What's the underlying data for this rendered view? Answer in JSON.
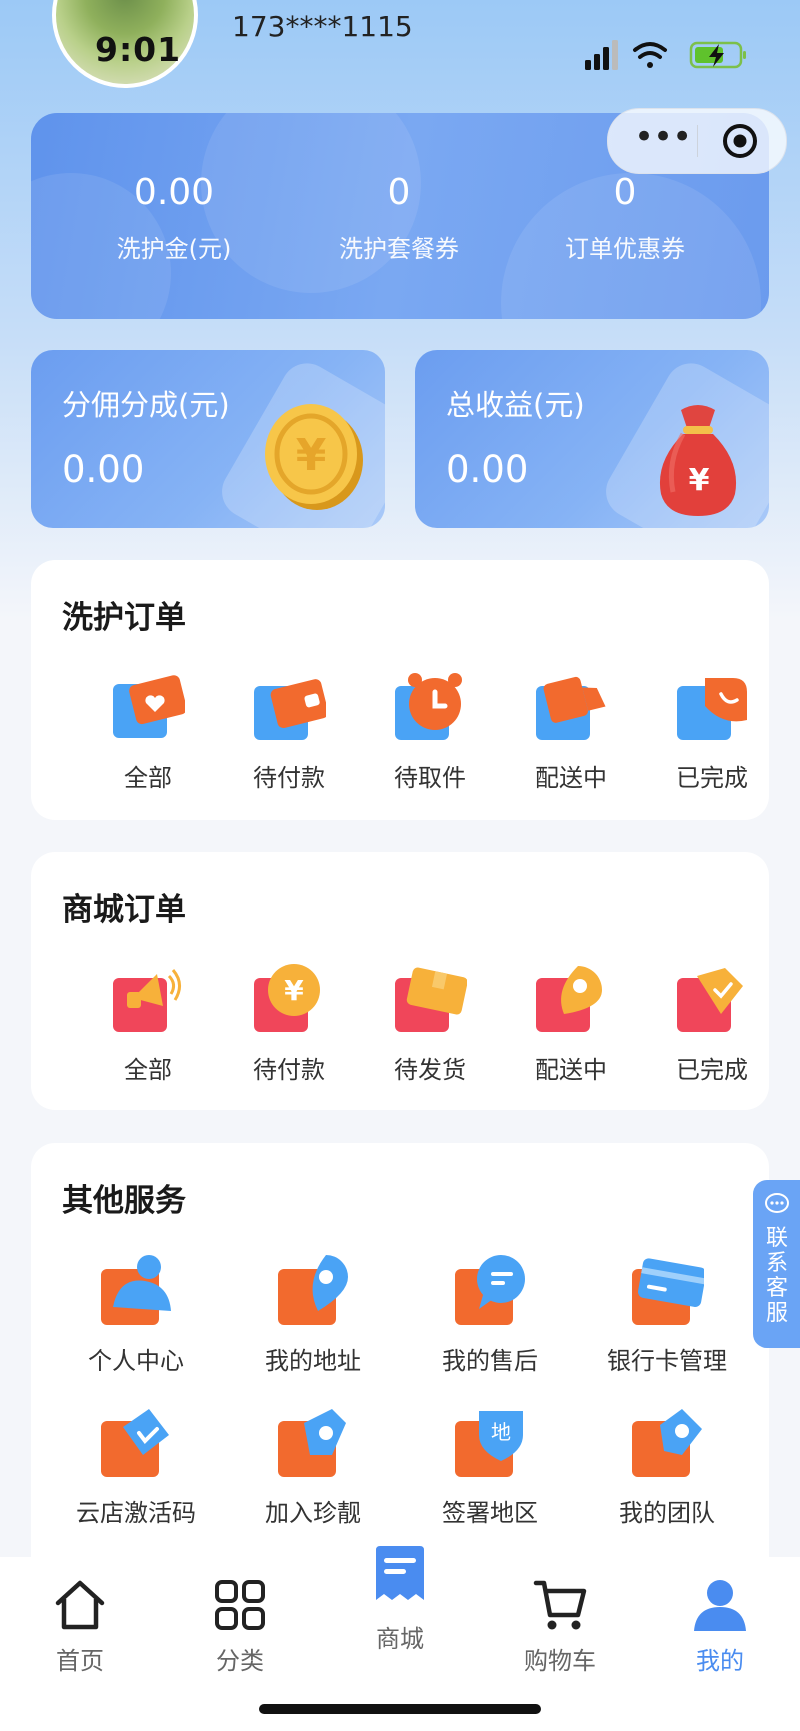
{
  "status_bar": {
    "time": "9:01",
    "phone": "173****1115"
  },
  "stats": [
    {
      "value": "0.00",
      "label": "洗护金(元)"
    },
    {
      "value": "0",
      "label": "洗护套餐券"
    },
    {
      "value": "0",
      "label": "订单优惠券"
    }
  ],
  "earnings": {
    "commission": {
      "label": "分佣分成(元)",
      "value": "0.00"
    },
    "total": {
      "label": "总收益(元)",
      "value": "0.00"
    }
  },
  "wash_orders": {
    "title": "洗护订单",
    "items": [
      {
        "label": "全部",
        "icon": "wallet-heart-icon"
      },
      {
        "label": "待付款",
        "icon": "wallet-icon"
      },
      {
        "label": "待取件",
        "icon": "alarm-clock-icon"
      },
      {
        "label": "配送中",
        "icon": "delivery-truck-icon"
      },
      {
        "label": "已完成",
        "icon": "complete-icon"
      }
    ]
  },
  "mall_orders": {
    "title": "商城订单",
    "items": [
      {
        "label": "全部",
        "icon": "megaphone-icon"
      },
      {
        "label": "待付款",
        "icon": "yen-coin-icon"
      },
      {
        "label": "待发货",
        "icon": "package-icon"
      },
      {
        "label": "配送中",
        "icon": "location-pin-icon"
      },
      {
        "label": "已完成",
        "icon": "shield-check-icon"
      }
    ]
  },
  "other_services": {
    "title": "其他服务",
    "items": [
      {
        "label": "个人中心",
        "icon": "person-icon"
      },
      {
        "label": "我的地址",
        "icon": "map-pin-icon"
      },
      {
        "label": "我的售后",
        "icon": "chat-bubble-icon"
      },
      {
        "label": "银行卡管理",
        "icon": "bank-card-icon"
      },
      {
        "label": "云店激活码",
        "icon": "activation-tag-icon"
      },
      {
        "label": "加入珍靓",
        "icon": "join-tag-icon"
      },
      {
        "label": "签署地区",
        "icon": "region-shield-icon"
      },
      {
        "label": "我的团队",
        "icon": "team-tag-icon"
      }
    ],
    "region_glyph": "地"
  },
  "contact": {
    "label": "联系客服"
  },
  "tabbar": [
    {
      "label": "首页",
      "icon": "home-icon"
    },
    {
      "label": "分类",
      "icon": "category-grid-icon"
    },
    {
      "label": "商城",
      "icon": "mall-receipt-icon"
    },
    {
      "label": "购物车",
      "icon": "shopping-cart-icon"
    },
    {
      "label": "我的",
      "icon": "profile-icon",
      "active": true
    }
  ],
  "colors": {
    "accent": "#4a8cf0",
    "card_blue": "#6b9bee",
    "orange": "#f26a2e"
  }
}
